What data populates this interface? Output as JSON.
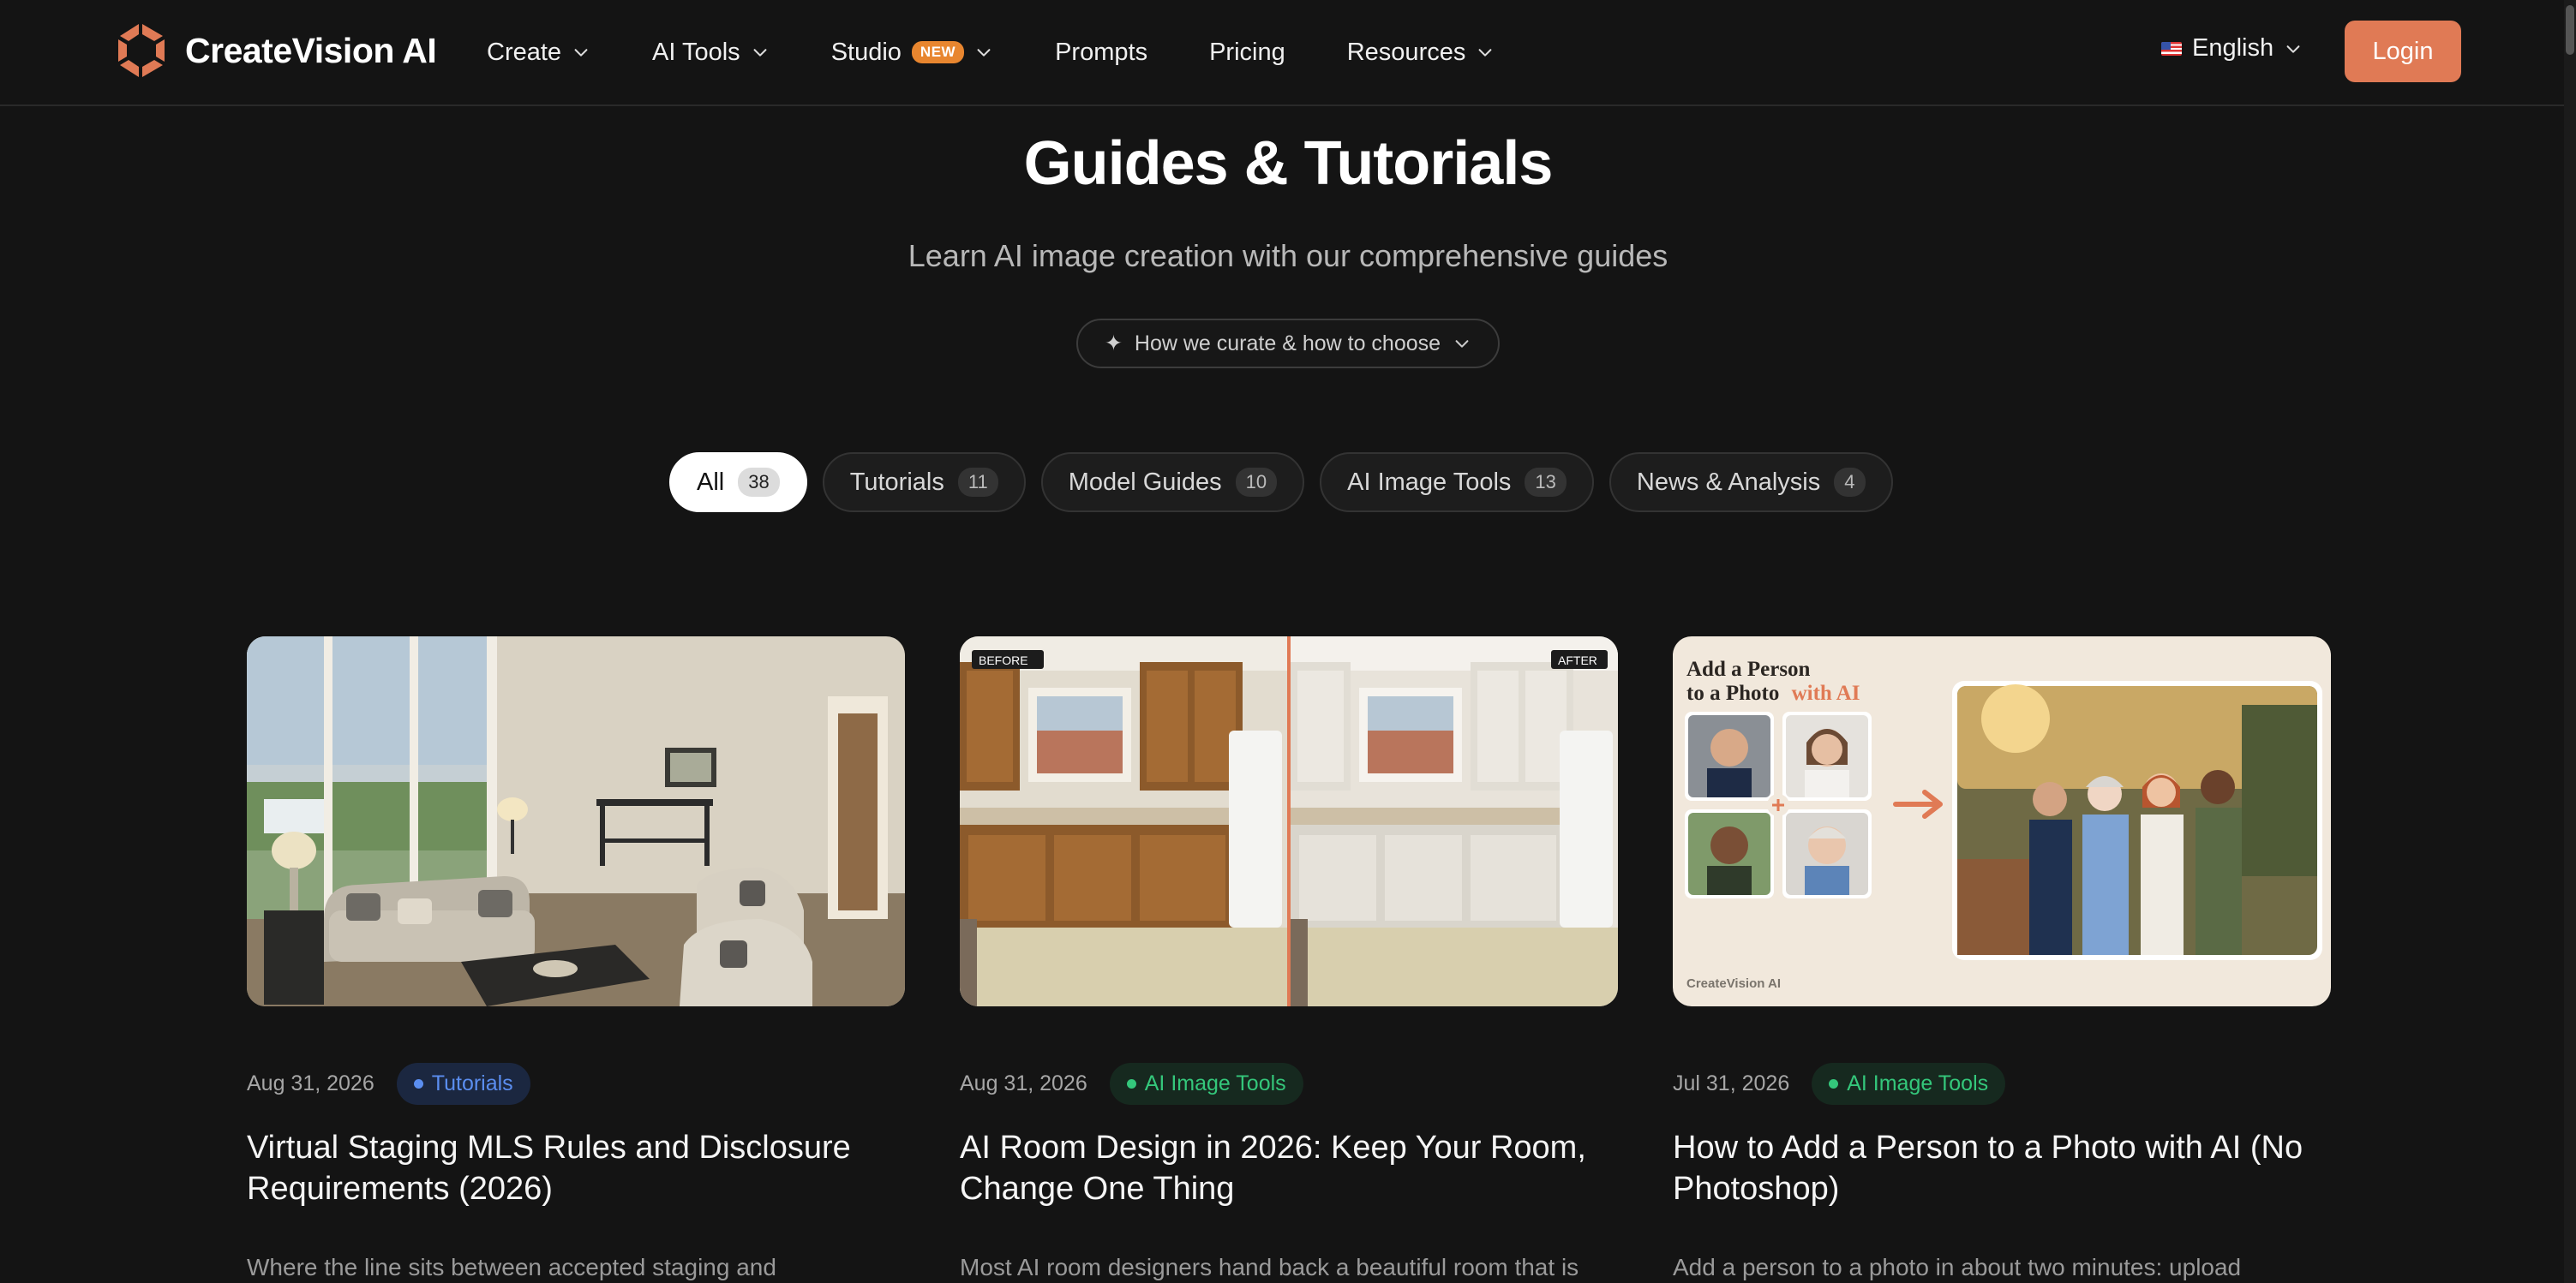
{
  "brand": {
    "name": "CreateVision AI"
  },
  "nav": {
    "items": [
      {
        "label": "Create",
        "dropdown": true
      },
      {
        "label": "AI Tools",
        "dropdown": true
      },
      {
        "label": "Studio",
        "badge": "NEW",
        "dropdown": true
      },
      {
        "label": "Prompts",
        "dropdown": false
      },
      {
        "label": "Pricing",
        "dropdown": false
      },
      {
        "label": "Resources",
        "dropdown": true
      }
    ]
  },
  "language": {
    "label": "English",
    "icon": "us-flag-icon"
  },
  "login": {
    "label": "Login"
  },
  "hero": {
    "title": "Guides & Tutorials",
    "subtitle": "Learn AI image creation with our comprehensive guides",
    "curate_label": "How we curate & how to choose",
    "curate_icon": "✦"
  },
  "filters": [
    {
      "label": "All",
      "count": "38",
      "active": true
    },
    {
      "label": "Tutorials",
      "count": "11",
      "active": false
    },
    {
      "label": "Model Guides",
      "count": "10",
      "active": false
    },
    {
      "label": "AI Image Tools",
      "count": "13",
      "active": false
    },
    {
      "label": "News & Analysis",
      "count": "4",
      "active": false
    }
  ],
  "cards": [
    {
      "date": "Aug 31, 2026",
      "tag": "Tutorials",
      "tag_color": "#5b8ef0",
      "title": "Virtual Staging MLS Rules and Disclosure Requirements (2026)",
      "excerpt": "Where the line sits between accepted staging and",
      "image": "staged-living-room"
    },
    {
      "date": "Aug 31, 2026",
      "tag": "AI Image Tools",
      "tag_color": "#34c77b",
      "title": "AI Room Design in 2026: Keep Your Room, Change One Thing",
      "excerpt": "Most AI room designers hand back a beautiful room that is",
      "image": "kitchen-before-after",
      "before_label": "BEFORE",
      "after_label": "AFTER"
    },
    {
      "date": "Jul 31, 2026",
      "tag": "AI Image Tools",
      "tag_color": "#34c77b",
      "title": "How to Add a Person to a Photo with AI (No Photoshop)",
      "excerpt": "Add a person to a photo in about two minutes: upload",
      "image": "add-person-composite",
      "thumb_heading_1": "Add a Person",
      "thumb_heading_2": "to a Photo",
      "thumb_heading_accent": "with AI",
      "thumb_watermark": "CreateVision AI"
    }
  ],
  "colors": {
    "background": "#141414",
    "accent": "#e07a55",
    "new_badge": "#e8862f",
    "tag_blue": "#5b8ef0",
    "tag_green": "#34c77b"
  }
}
